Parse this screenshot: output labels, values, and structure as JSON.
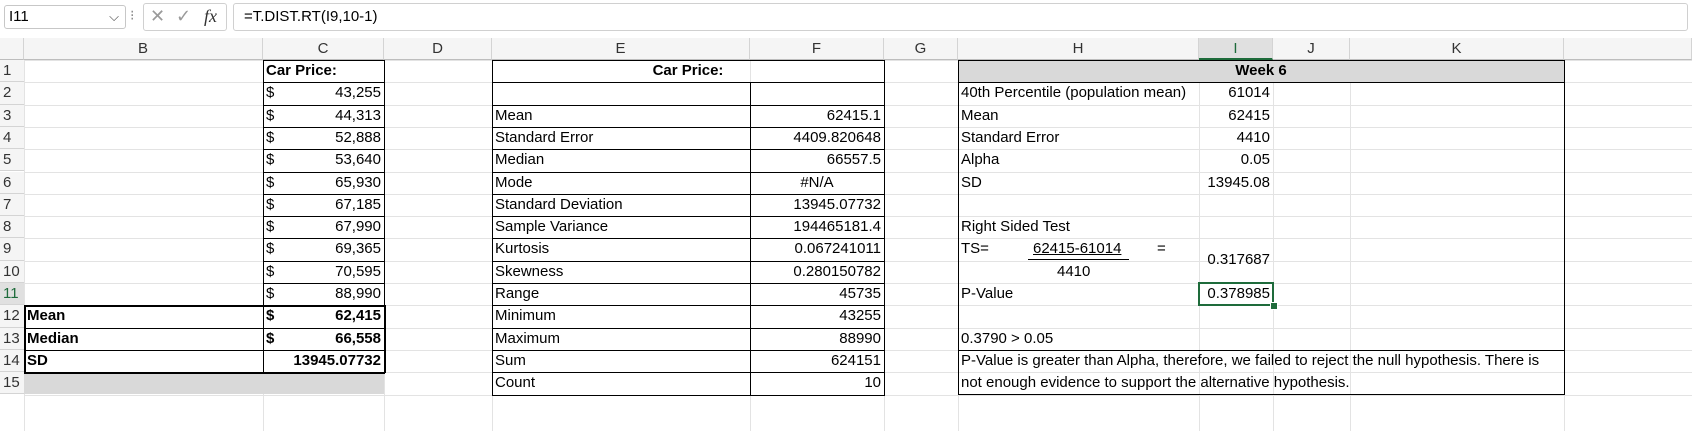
{
  "formula_bar": {
    "name_box": "I11",
    "cancel_icon": "✕",
    "enter_icon": "✓",
    "fx_label": "fx",
    "formula": "=T.DIST.RT(I9,10-1)"
  },
  "columns": [
    "B",
    "C",
    "D",
    "E",
    "F",
    "G",
    "H",
    "I",
    "J",
    "K"
  ],
  "rows": [
    "1",
    "2",
    "3",
    "4",
    "5",
    "6",
    "7",
    "8",
    "9",
    "10",
    "11",
    "12",
    "13",
    "14",
    "15"
  ],
  "colC": {
    "header": "Car Price:",
    "currency": "$",
    "values": [
      "43,255",
      "44,313",
      "52,888",
      "53,640",
      "65,930",
      "67,185",
      "67,990",
      "69,365",
      "70,595",
      "88,990"
    ]
  },
  "summaryB": {
    "mean_label": "Mean",
    "median_label": "Median",
    "sd_label": "SD",
    "mean_value": "62,415",
    "median_value": "66,558",
    "sd_value": "13945.07732"
  },
  "stats": {
    "header": "Car Price:",
    "labels": [
      "Mean",
      "Standard Error",
      "Median",
      "Mode",
      "Standard Deviation",
      "Sample Variance",
      "Kurtosis",
      "Skewness",
      "Range",
      "Minimum",
      "Maximum",
      "Sum",
      "Count"
    ],
    "values": [
      "62415.1",
      "4409.820648",
      "66557.5",
      "#N/A",
      "13945.07732",
      "194465181.4",
      "0.067241011",
      "0.280150782",
      "45735",
      "43255",
      "88990",
      "624151",
      "10"
    ]
  },
  "week6": {
    "header": "Week 6",
    "labels": [
      "40th Percentile (population mean)",
      "Mean",
      "Standard Error",
      "Alpha",
      "SD"
    ],
    "values": [
      "61014",
      "62415",
      "4410",
      "0.05",
      "13945.08"
    ],
    "test_title": "Right Sided Test",
    "ts_label": "TS=",
    "numerator": "62415-61014",
    "equals": "=",
    "denominator": "4410",
    "ts_value": "0.317687",
    "pvalue_label": "P-Value",
    "pvalue": "0.378985",
    "comparison": "0.3790 > 0.05",
    "conclusion": "P-Value is greater than Alpha, therefore, we failed to reject the null hypothesis. There is not enough evidence to support the alternative hypothesis."
  }
}
